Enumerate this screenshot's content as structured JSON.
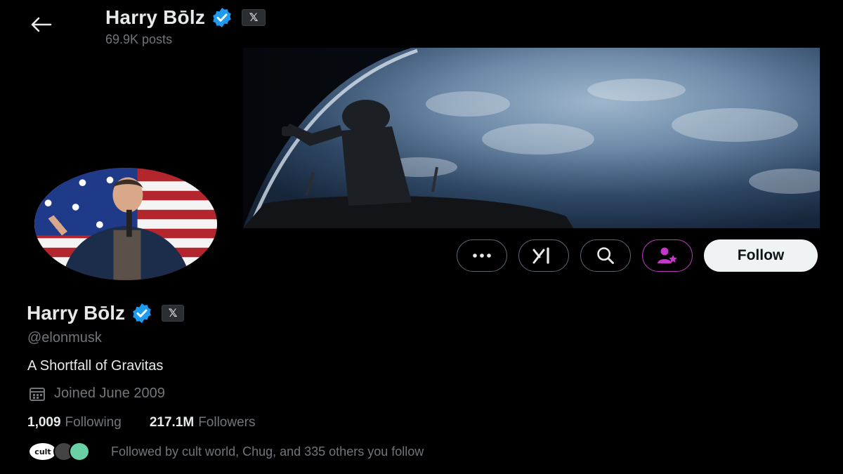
{
  "header": {
    "back_icon": "back-arrow-icon",
    "name": "Harry Bōlz",
    "posts_count": "69.9K posts"
  },
  "badge": {
    "x_glyph": "𝕏",
    "verified_color": "#1d9bf0"
  },
  "actions": {
    "more_icon": "more-horizontal-icon",
    "grok_icon": "grok-icon",
    "search_icon": "search-icon",
    "subscribe_icon": "subscribe-person-star-icon",
    "follow_label": "Follow",
    "subscribe_color": "#c637c9"
  },
  "profile": {
    "name": "Harry Bōlz",
    "handle": "@elonmusk",
    "bio": "A Shortfall of Gravitas",
    "joined_icon": "calendar-icon",
    "joined": "Joined June 2009",
    "following_count": "1,009",
    "following_label": "Following",
    "followers_count": "217.1M",
    "followers_label": "Followers",
    "followed_by_avatars": [
      "cult",
      "",
      ""
    ],
    "followed_by_text": "Followed by cult world, Chug, and 335 others you follow"
  }
}
